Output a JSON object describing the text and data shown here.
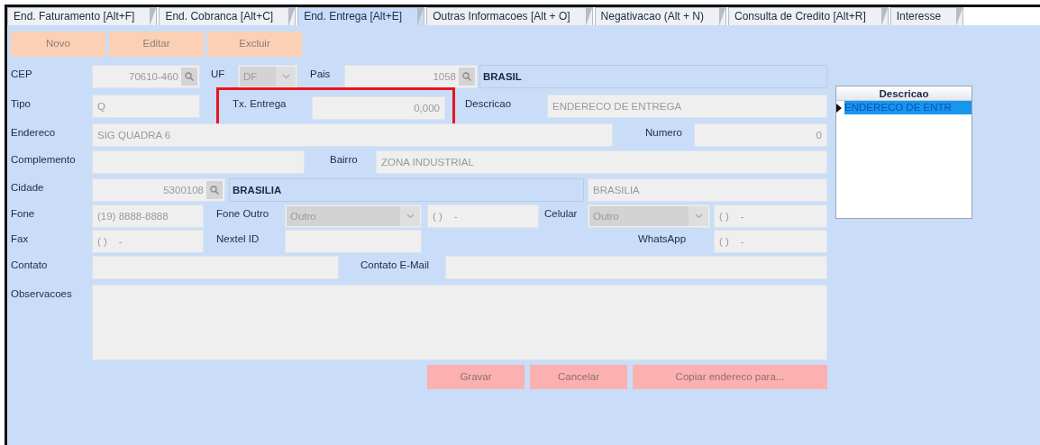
{
  "tabs": [
    {
      "label": "End. Faturamento [Alt+F]",
      "selected": false
    },
    {
      "label": "End. Cobranca [Alt+C]",
      "selected": false
    },
    {
      "label": "End. Entrega [Alt+E]",
      "selected": true
    },
    {
      "label": "Outras Informacoes [Alt + O]",
      "selected": false
    },
    {
      "label": "Negativacao (Alt + N)",
      "selected": false
    },
    {
      "label": "Consulta de Credito [Alt+R]",
      "selected": false
    },
    {
      "label": "Interesse",
      "selected": false
    }
  ],
  "toolbar": [
    "Novo",
    "Editar",
    "Excluir"
  ],
  "form": {
    "cep": {
      "label": "CEP",
      "value": "70610-460"
    },
    "uf": {
      "label": "UF",
      "value": "DF"
    },
    "pais": {
      "label": "Pais",
      "code": "1058",
      "name": "BRASIL"
    },
    "tipo": {
      "label": "Tipo",
      "value": "Q"
    },
    "tx_entrega": {
      "label": "Tx. Entrega",
      "value": "0,000",
      "highlighted": true
    },
    "descricao": {
      "label": "Descricao",
      "value": "ENDERECO DE ENTREGA"
    },
    "endereco": {
      "label": "Endereco",
      "value": "SIG QUADRA 6"
    },
    "numero": {
      "label": "Numero",
      "value": "0"
    },
    "complemento": {
      "label": "Complemento"
    },
    "bairro": {
      "label": "Bairro",
      "value": "ZONA INDUSTRIAL"
    },
    "cidade": {
      "label": "Cidade",
      "code": "5300108",
      "name": "BRASILIA",
      "field_3": "BRASILIA"
    },
    "fone": {
      "label": "Fone",
      "value": "(19) 8888-8888"
    },
    "fone_outro": {
      "label": "Fone Outro",
      "type": "Outro",
      "value": "( )    -"
    },
    "celular": {
      "label": "Celular",
      "type": "Outro",
      "value": "( )    -"
    },
    "fax": {
      "label": "Fax",
      "value": "( )    -"
    },
    "nextel_id": {
      "label": "Nextel ID"
    },
    "whatsapp": {
      "label": "WhatsApp",
      "value": "( )    -"
    },
    "contato": {
      "label": "Contato"
    },
    "contato_email": {
      "label": "Contato E-Mail"
    },
    "observacoes": {
      "label": "Observacoes"
    }
  },
  "actions": [
    "Gravar",
    "Cancelar",
    "Copiar endereco para..."
  ],
  "grid": {
    "column": "Descricao",
    "rows": [
      {
        "text": "ENDERECO DE ENTR",
        "selected": true
      }
    ]
  }
}
